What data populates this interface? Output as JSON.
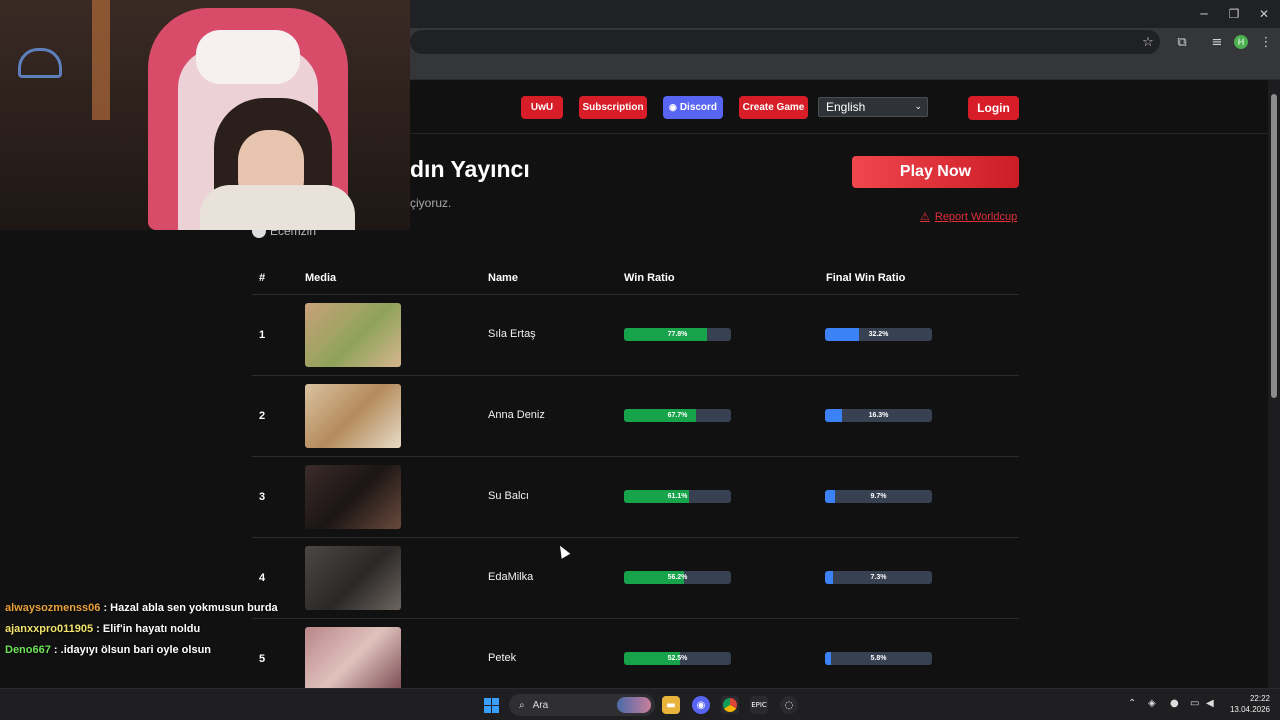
{
  "browser": {
    "minimize_icon": "─",
    "restore_icon": "❐",
    "close_icon": "✕",
    "star_icon": "☆",
    "profile_initial": "H"
  },
  "nav": {
    "uwu": "UwU",
    "subscription": "Subscription",
    "discord": "Discord",
    "create_game": "Create Game",
    "language": "English",
    "login": "Login"
  },
  "hero": {
    "title": "dın Yayıncı",
    "subtitle": "çiyoruz.",
    "streamer": "Ecemzin",
    "play_now": "Play Now",
    "report": "Report Worldcup"
  },
  "table": {
    "headers": {
      "rank": "#",
      "media": "Media",
      "name": "Name",
      "win": "Win Ratio",
      "final": "Final Win Ratio"
    },
    "rows": [
      {
        "rank": "1",
        "name": "Sıla Ertaş",
        "win": 77.8,
        "win_label": "77.8%",
        "final": 32.2,
        "final_label": "32.2%"
      },
      {
        "rank": "2",
        "name": "Anna Deniz",
        "win": 67.7,
        "win_label": "67.7%",
        "final": 16.3,
        "final_label": "16.3%"
      },
      {
        "rank": "3",
        "name": "Su Balcı",
        "win": 61.1,
        "win_label": "61.1%",
        "final": 9.7,
        "final_label": "9.7%"
      },
      {
        "rank": "4",
        "name": "EdaMilka",
        "win": 56.2,
        "win_label": "56.2%",
        "final": 7.3,
        "final_label": "7.3%"
      },
      {
        "rank": "5",
        "name": "Petek",
        "win": 52.5,
        "win_label": "52.5%",
        "final": 5.8,
        "final_label": "5.8%"
      }
    ]
  },
  "chat": [
    {
      "user": "alwaysozmenss06",
      "text": ": Hazal abla sen yokmusun burda",
      "color": "#e9a23b"
    },
    {
      "user": "ajanxxpro011905",
      "text": ": Elif'in hayatı noldu",
      "color": "#f1e36b"
    },
    {
      "user": "Deno667",
      "text": ": .idayıyı ölsun bari oyle olsun",
      "color": "#6ee35a"
    }
  ],
  "taskbar": {
    "search": "Ara",
    "time": "22:22",
    "date": "13.04.2026"
  }
}
